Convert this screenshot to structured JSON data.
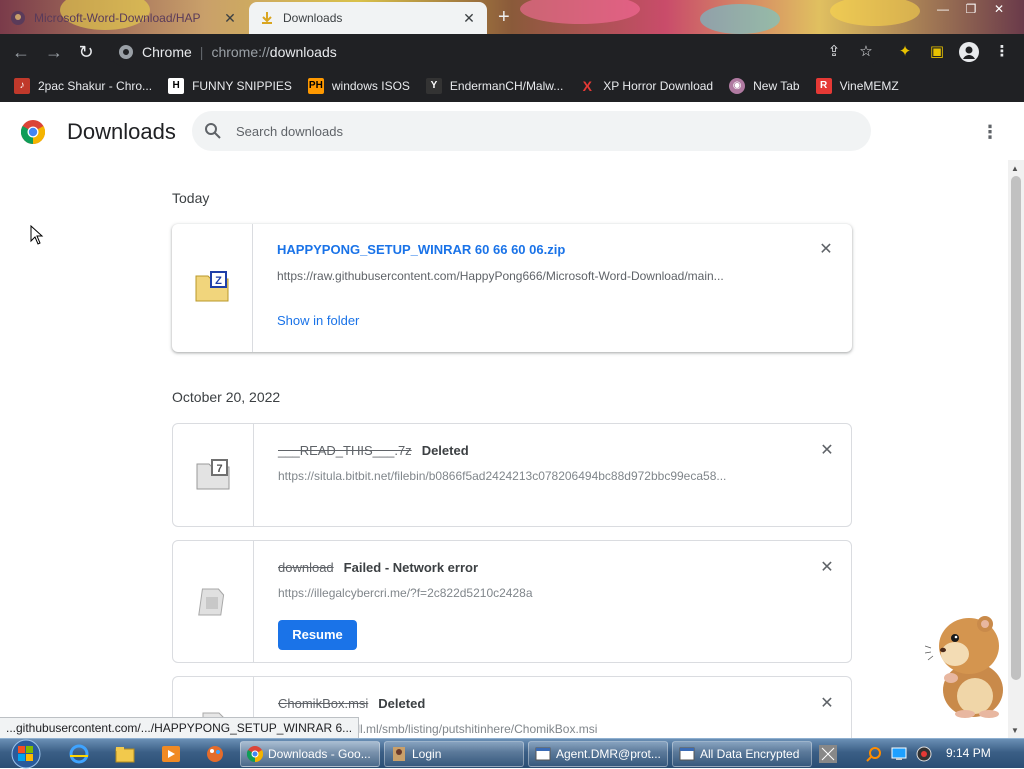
{
  "browser": {
    "tabs": [
      {
        "title": "Microsoft-Word-Download/HAP",
        "active": false
      },
      {
        "title": "Downloads",
        "active": true
      }
    ],
    "new_tab_symbol": "+",
    "address": {
      "site_label": "Chrome",
      "scheme": "chrome://",
      "path": "downloads"
    },
    "bookmarks": [
      {
        "label": "2pac Shakur - Chro...",
        "icon": "2pac-favicon"
      },
      {
        "label": "FUNNY SNIPPIES",
        "icon": "h-favicon"
      },
      {
        "label": "windows ISOS",
        "icon": "ph-favicon"
      },
      {
        "label": "EndermanCH/Malw...",
        "icon": "yt-favicon"
      },
      {
        "label": "XP Horror Download",
        "icon": "x-favicon"
      },
      {
        "label": "New Tab",
        "icon": "globe-favicon"
      },
      {
        "label": "VineMEMZ",
        "icon": "r-favicon"
      }
    ]
  },
  "page": {
    "title": "Downloads",
    "search_placeholder": "Search downloads"
  },
  "sections": [
    {
      "date": "Today"
    },
    {
      "date": "October 20, 2022"
    }
  ],
  "downloads": [
    {
      "filename": "HAPPYPONG_SETUP_WINRAR 60 66 60 06.zip",
      "status": "",
      "url": "https://raw.githubusercontent.com/HappyPong666/Microsoft-Word-Download/main...",
      "action": "Show in folder"
    },
    {
      "filename": "___READ_THIS___.7z",
      "status": "Deleted",
      "url": "https://situla.bitbit.net/filebin/b0866f5ad2424213c078206494bc88d972bbc99eca58...",
      "action": ""
    },
    {
      "filename": "download",
      "status": "Failed - Network error",
      "url": "https://illegalcybercri.me/?f=2c822d5210c2428a",
      "action": "Resume"
    },
    {
      "filename": "ChomikBox.msi",
      "status": "Deleted",
      "url": "https://beingtroll.ml/smb/listing/putshitinhere/ChomikBox.msi",
      "action": ""
    }
  ],
  "status_bubble": "...githubusercontent.com/.../HAPPYPONG_SETUP_WINRAR 6...",
  "taskbar": {
    "tasks": [
      {
        "label": "Downloads - Goo...",
        "icon": "chrome-icon",
        "active": true
      },
      {
        "label": "Login",
        "icon": "app-icon",
        "active": false
      },
      {
        "label": "Agent.DMR@prot...",
        "icon": "window-icon",
        "active": false
      },
      {
        "label": "All Data Encrypted",
        "icon": "window-icon",
        "active": false
      }
    ],
    "clock": "9:14 PM"
  },
  "colors": {
    "accent": "#1a73e8",
    "toolbar": "#202124",
    "taskbar": "#3b5f86"
  }
}
